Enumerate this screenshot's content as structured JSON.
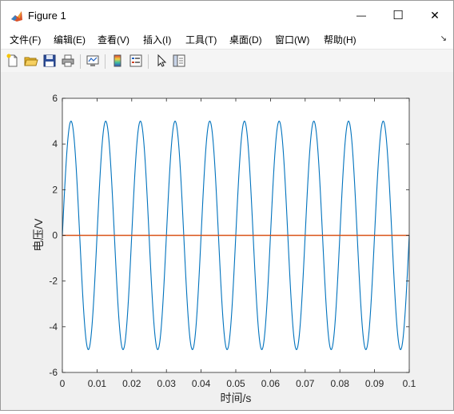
{
  "window": {
    "title": "Figure 1",
    "minimize_glyph": "—",
    "maximize_glyph": "☐",
    "close_glyph": "✕"
  },
  "menu": {
    "items": [
      "文件(F)",
      "编辑(E)",
      "查看(V)",
      "插入(I)",
      "工具(T)",
      "桌面(D)",
      "窗口(W)",
      "帮助(H)"
    ]
  },
  "toolbar": {
    "buttons": [
      "new-figure-icon",
      "open-file-icon",
      "save-icon",
      "print-icon",
      "link-plot-icon",
      "insert-colorbar-icon",
      "insert-legend-icon",
      "pointer-icon",
      "property-editor-icon"
    ]
  },
  "colors": {
    "series_1": "#0072BD",
    "series_2": "#D95319"
  },
  "chart_data": {
    "type": "line",
    "xlabel": "时间/s",
    "ylabel": "电压/V",
    "xlim": [
      0,
      0.1
    ],
    "ylim": [
      -6,
      6
    ],
    "xticks": [
      "0",
      "0.01",
      "0.02",
      "0.03",
      "0.04",
      "0.05",
      "0.06",
      "0.07",
      "0.08",
      "0.09",
      "0.1"
    ],
    "yticks": [
      "6",
      "4",
      "2",
      "0",
      "-2",
      "-4",
      "-6"
    ],
    "grid": false,
    "series": [
      {
        "function": "sine",
        "amplitude": 5,
        "frequency_hz": 100,
        "x_start": 0,
        "x_end": 0.1,
        "color": "#0072BD"
      },
      {
        "function": "constant",
        "value": 0,
        "x_start": 0,
        "x_end": 0.1,
        "color": "#D95319"
      }
    ]
  }
}
